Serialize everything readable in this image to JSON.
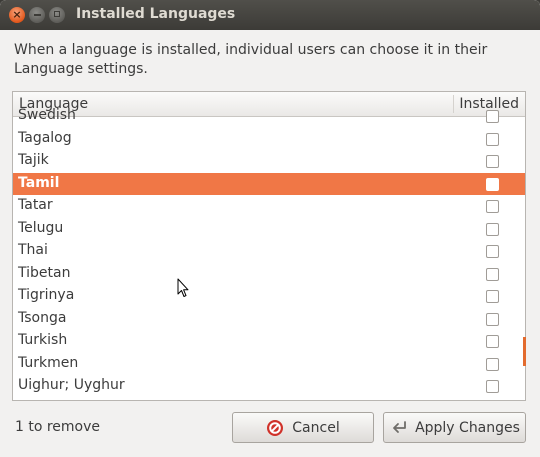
{
  "window": {
    "title": "Installed Languages",
    "buttons": [
      "close-icon",
      "minimize-icon",
      "maximize-icon"
    ]
  },
  "description": "When a language is installed, individual users can choose it in their Language settings.",
  "table": {
    "headers": {
      "language": "Language",
      "installed": "Installed"
    },
    "rows": [
      {
        "label": "Swedish",
        "installed": false
      },
      {
        "label": "Tagalog",
        "installed": false
      },
      {
        "label": "Tajik",
        "installed": false
      },
      {
        "label": "Tamil",
        "installed": false,
        "selected": true
      },
      {
        "label": "Tatar",
        "installed": false
      },
      {
        "label": "Telugu",
        "installed": false
      },
      {
        "label": "Thai",
        "installed": false
      },
      {
        "label": "Tibetan",
        "installed": false
      },
      {
        "label": "Tigrinya",
        "installed": false
      },
      {
        "label": "Tsonga",
        "installed": false
      },
      {
        "label": "Turkish",
        "installed": false
      },
      {
        "label": "Turkmen",
        "installed": false
      },
      {
        "label": "Uighur; Uyghur",
        "installed": false
      }
    ]
  },
  "status": "1 to remove",
  "buttons": {
    "cancel": {
      "label": "Cancel",
      "icon": "cancel-icon"
    },
    "apply": {
      "label": "Apply Changes",
      "icon": "apply-icon"
    }
  },
  "colors": {
    "selection": "#f07746",
    "titlebar": "#3c3b37",
    "window_bg": "#f2f1f0"
  }
}
